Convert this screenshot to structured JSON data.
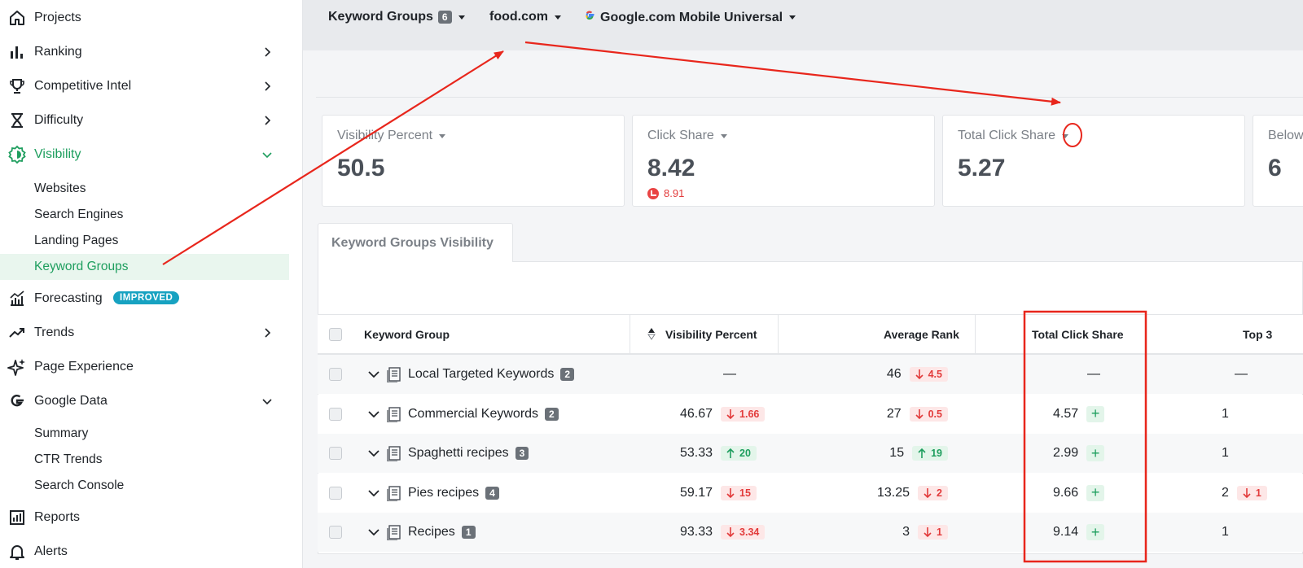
{
  "sidebar": {
    "items": [
      {
        "label": "Projects"
      },
      {
        "label": "Ranking"
      },
      {
        "label": "Competitive Intel"
      },
      {
        "label": "Difficulty"
      },
      {
        "label": "Visibility"
      },
      {
        "label": "Forecasting",
        "badge": "IMPROVED"
      },
      {
        "label": "Trends"
      },
      {
        "label": "Page Experience"
      },
      {
        "label": "Google Data"
      },
      {
        "label": "Reports"
      },
      {
        "label": "Alerts"
      }
    ],
    "visibility_sub": [
      "Websites",
      "Search Engines",
      "Landing Pages",
      "Keyword Groups"
    ],
    "google_sub": [
      "Summary",
      "CTR Trends",
      "Search Console"
    ]
  },
  "topbar": {
    "keyword_groups": "Keyword Groups",
    "keyword_groups_count": "6",
    "site": "food.com",
    "engine": "Google.com Mobile Universal"
  },
  "cards": [
    {
      "title": "Visibility Percent",
      "value": "50.5"
    },
    {
      "title": "Click Share",
      "value": "8.42",
      "delta": "8.91"
    },
    {
      "title": "Total Click Share",
      "value": "5.27"
    },
    {
      "title": "Below",
      "value": "6"
    }
  ],
  "tab_label": "Keyword Groups Visibility",
  "table": {
    "headers": [
      "Keyword Group",
      "Visibility Percent",
      "Average Rank",
      "Total Click Share",
      "Top 3"
    ],
    "rows": [
      {
        "name": "Local Targeted Keywords",
        "count": "2",
        "vis": "—",
        "vis_delta": "",
        "vis_dir": "",
        "rank": "46",
        "rank_delta": "4.5",
        "rank_dir": "down",
        "tcs": "—",
        "tcs_plus": false,
        "top3": "—",
        "top3_delta": ""
      },
      {
        "name": "Commercial Keywords",
        "count": "2",
        "vis": "46.67",
        "vis_delta": "1.66",
        "vis_dir": "down",
        "rank": "27",
        "rank_delta": "0.5",
        "rank_dir": "down",
        "tcs": "4.57",
        "tcs_plus": true,
        "top3": "1",
        "top3_delta": ""
      },
      {
        "name": "Spaghetti recipes",
        "count": "3",
        "vis": "53.33",
        "vis_delta": "20",
        "vis_dir": "up",
        "rank": "15",
        "rank_delta": "19",
        "rank_dir": "up",
        "tcs": "2.99",
        "tcs_plus": true,
        "top3": "1",
        "top3_delta": ""
      },
      {
        "name": "Pies recipes",
        "count": "4",
        "vis": "59.17",
        "vis_delta": "15",
        "vis_dir": "down",
        "rank": "13.25",
        "rank_delta": "2",
        "rank_dir": "down",
        "tcs": "9.66",
        "tcs_plus": true,
        "top3": "2",
        "top3_delta": "1"
      },
      {
        "name": "Recipes",
        "count": "1",
        "vis": "93.33",
        "vis_delta": "3.34",
        "vis_dir": "down",
        "rank": "3",
        "rank_delta": "1",
        "rank_dir": "down",
        "tcs": "9.14",
        "tcs_plus": true,
        "top3": "1",
        "top3_delta": ""
      }
    ]
  },
  "colors": {
    "accent_green": "#1e9e5e",
    "annotation_red": "#e8261c",
    "badge_teal": "#17a2c1"
  }
}
